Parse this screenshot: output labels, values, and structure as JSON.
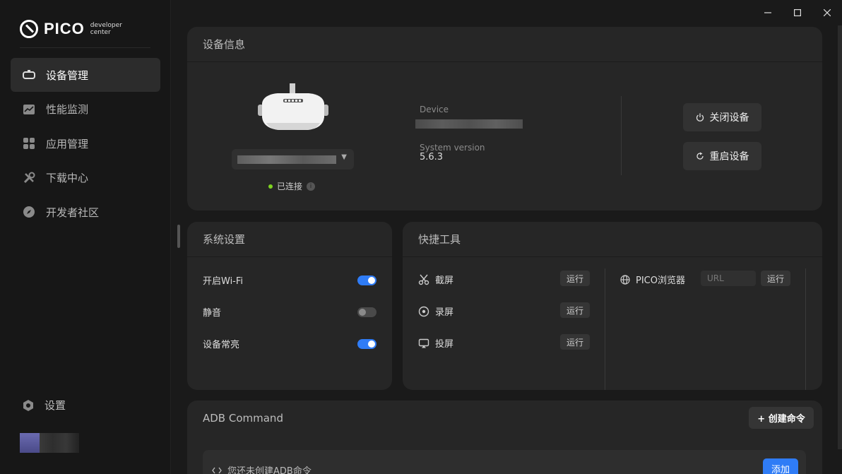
{
  "app": {
    "logo_text": "PICO",
    "logo_sub1": "developer",
    "logo_sub2": "center"
  },
  "sidebar": {
    "items": [
      {
        "label": "设备管理",
        "icon": "headset-icon",
        "active": true
      },
      {
        "label": "性能监测",
        "icon": "chart-icon",
        "active": false
      },
      {
        "label": "应用管理",
        "icon": "apps-grid-icon",
        "active": false
      },
      {
        "label": "下载中心",
        "icon": "tools-icon",
        "active": false
      },
      {
        "label": "开发者社区",
        "icon": "compass-icon",
        "active": false
      }
    ],
    "settings_label": "设置"
  },
  "device_info": {
    "title": "设备信息",
    "status": "已连接",
    "device_label": "Device",
    "system_version_label": "System version",
    "system_version": "5.6.3",
    "shutdown_label": "关闭设备",
    "restart_label": "重启设备"
  },
  "system_settings": {
    "title": "系统设置",
    "toggles": [
      {
        "label": "开启Wi-Fi",
        "on": true
      },
      {
        "label": "静音",
        "on": false
      },
      {
        "label": "设备常亮",
        "on": true
      }
    ]
  },
  "quick_tools": {
    "title": "快捷工具",
    "tools": [
      {
        "label": "截屏",
        "run": "运行",
        "icon": "scissors-icon"
      },
      {
        "label": "录屏",
        "run": "运行",
        "icon": "record-icon"
      },
      {
        "label": "投屏",
        "run": "运行",
        "icon": "cast-icon"
      }
    ],
    "browser_label": "PICO浏览器",
    "url_placeholder": "URL",
    "browser_run": "运行"
  },
  "adb": {
    "title": "ADB Command",
    "create_label": "+ 创建命令",
    "empty_text": "您还未创建ADB命令",
    "add_label": "添加"
  },
  "colors": {
    "accent": "#2f7cf6",
    "status_green": "#7ed321"
  }
}
